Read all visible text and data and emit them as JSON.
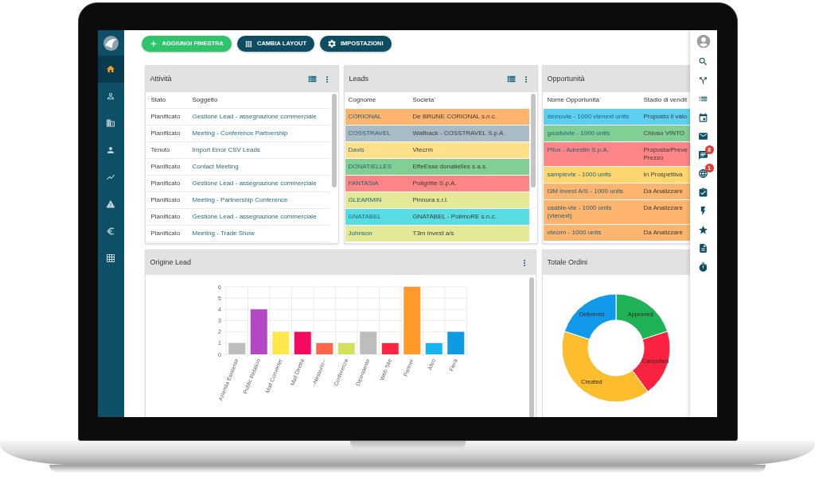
{
  "sidebar": {
    "items": [
      {
        "selected": true
      },
      {
        "selected": false
      },
      {
        "selected": false
      },
      {
        "selected": false
      },
      {
        "selected": false
      },
      {
        "selected": false
      },
      {
        "selected": false
      },
      {
        "selected": false
      }
    ]
  },
  "toolbar": {
    "buttons": [
      {
        "label": "AGGIUNGI FINESTRA",
        "kind": "primary"
      },
      {
        "label": "CAMBIA LAYOUT",
        "kind": "secondary"
      },
      {
        "label": "IMPOSTAZIONI",
        "kind": "secondary"
      }
    ]
  },
  "attivita": {
    "title": "Attività",
    "columns": [
      "Stato",
      "Soggetto"
    ],
    "rows": [
      [
        "Pianificato",
        "Gestione Lead - assegnazione commerciale"
      ],
      [
        "Pianificato",
        "Meeting - Conference Partnership"
      ],
      [
        "Tenuto",
        "Import Error CSV Leads"
      ],
      [
        "Pianificato",
        "Contact Meeting"
      ],
      [
        "Pianificato",
        "Gestione Lead - assegnazione commerciale"
      ],
      [
        "Pianificato",
        "Meeting - Partnership Conference"
      ],
      [
        "Pianificato",
        "Gestione Lead - assegnazione commerciale"
      ],
      [
        "Pianificato",
        "Meeting - Trade Show"
      ]
    ]
  },
  "leads": {
    "title": "Leads",
    "columns": [
      "Cognome",
      "Societa`"
    ],
    "rows": [
      {
        "cells": [
          "CORIONAL",
          "De BRUNE CORIONAL s.n.c."
        ],
        "color": "#fdb46e"
      },
      {
        "cells": [
          "COSSTRAVEL",
          "Wallback - COSSTRAVEL S.p.A."
        ],
        "color": "#a9bcc6"
      },
      {
        "cells": [
          "Davis",
          "Vtecrm"
        ],
        "color": "#fee08b"
      },
      {
        "cells": [
          "DONATIELLES",
          "EffeEsse donatielles s.a.s."
        ],
        "color": "#82cf96"
      },
      {
        "cells": [
          "FANTASIA",
          "Poligritte S.p.A."
        ],
        "color": "#fd8585"
      },
      {
        "cells": [
          "GLEARMIN",
          "Pinnura s.r.l."
        ],
        "color": "#e3e996"
      },
      {
        "cells": [
          "GNATABEL",
          "GNATABEL - PolimoRE s.n.c."
        ],
        "color": "#57dde2"
      },
      {
        "cells": [
          "Johnson",
          "T3m invest a/s"
        ],
        "color": "#e3e996"
      }
    ]
  },
  "opportunita": {
    "title": "Opportunità",
    "columns": [
      "Nome Opportunita`",
      "Stadio di vendit"
    ],
    "rows": [
      {
        "cells": [
          "demovte - 1000 vtenext units",
          "Proposto il valo"
        ],
        "color": "#5dd0f2"
      },
      {
        "cells": [
          "gooduivte - 1000 units",
          "Chiuso VINTO"
        ],
        "color": "#82cf96"
      },
      {
        "cells": [
          "Pilux - Adrestin S.p.A.",
          "Proposta/Preve\nPrezzo"
        ],
        "color": "#fd8585"
      },
      {
        "cells": [
          "samplevte - 1000 units",
          "In Prospettiva"
        ],
        "color": "#fed66f"
      },
      {
        "cells": [
          "t3M Invest A/S - 1000 units",
          "Da Analizzare"
        ],
        "color": "#fdb46e"
      },
      {
        "cells": [
          "usable-vte - 1000 units\n(vtenext)",
          "Da Analizzare"
        ],
        "color": "#fdb46e"
      },
      {
        "cells": [
          "vtecrm - 1000 units",
          "Da Analizzare"
        ],
        "color": "#fdb46e"
      }
    ]
  },
  "origine_lead": {
    "title": "Origine Lead",
    "chart_data": {
      "type": "bar",
      "categories": [
        "Azienda Esistente",
        "Public Relation",
        "Mail Converter",
        "Mail Diretta",
        "--Nessuno--",
        "Conferenza",
        "Dipendente",
        "Web Site",
        "Partner",
        "Altro",
        "Fiera"
      ],
      "values": [
        1,
        4,
        2,
        2,
        1,
        1,
        2,
        1,
        6,
        1,
        2
      ],
      "colors": [
        "#bdbdbd",
        "#b447c2",
        "#ffe94a",
        "#f50a5f",
        "#ff6547",
        "#d4e25b",
        "#bdbdbd",
        "#ff2442",
        "#ff9a2a",
        "#14b5f0",
        "#0f9be3"
      ],
      "ylim": [
        0,
        6
      ],
      "yticks": [
        0,
        1,
        2,
        3,
        4,
        5,
        6
      ],
      "grid": true
    }
  },
  "totale_ordini": {
    "title": "Totale Ordini",
    "chart_data": {
      "type": "donut",
      "categories": [
        "Approved",
        "Cancelled",
        "Created",
        "Delivered"
      ],
      "values": [
        20,
        20,
        40,
        20
      ],
      "colors": [
        "#1fb257",
        "#fb2240",
        "#fdbd2d",
        "#129aea"
      ]
    }
  },
  "right_toolbar": {
    "badges": [
      "8",
      "1"
    ]
  }
}
